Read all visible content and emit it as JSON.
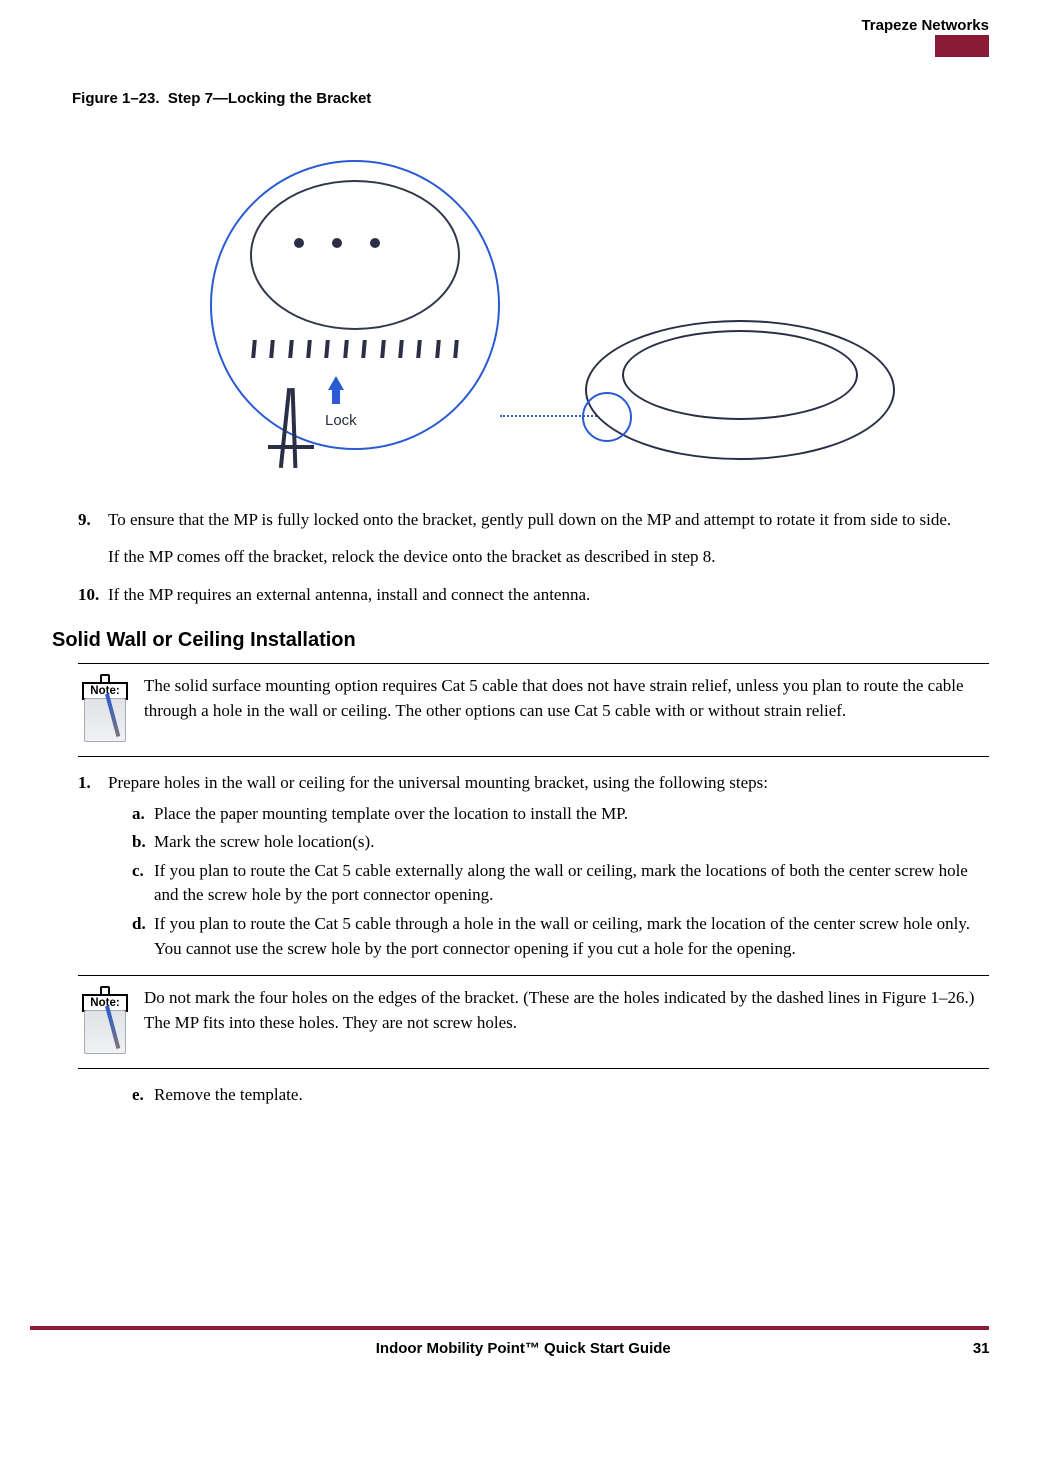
{
  "header": {
    "brand": "Trapeze Networks"
  },
  "figure": {
    "caption_prefix": "Figure 1–23.",
    "caption_title": "Step 7—Locking the Bracket",
    "lock_label": "Lock"
  },
  "steps_top": [
    {
      "num": "9.",
      "text": "To ensure that the MP is fully locked onto the bracket, gently pull down on the MP and attempt to rotate it from side to side.",
      "para2": "If the MP comes off the bracket, relock the device onto the bracket as described in step 8."
    },
    {
      "num": "10.",
      "text": "If the MP requires an external antenna, install and connect the antenna."
    }
  ],
  "section_title": "Solid Wall or Ceiling Installation",
  "note1": {
    "label": "Note:",
    "text": "The solid surface mounting option requires Cat 5 cable that does not have strain relief, unless you plan to route the cable through a hole in the wall or ceiling. The other options can use Cat 5 cable with or without strain relief."
  },
  "step1": {
    "num": "1.",
    "text": "Prepare holes in the wall or ceiling for the universal mounting bracket, using the following steps:",
    "subs": [
      {
        "lab": "a.",
        "text": "Place the paper mounting template over the location to install the MP."
      },
      {
        "lab": "b.",
        "text": "Mark the screw hole location(s)."
      },
      {
        "lab": "c.",
        "text": "If you plan to route the Cat 5 cable externally along the wall or ceiling, mark the locations of both the center screw hole and the screw hole by the port connector opening."
      },
      {
        "lab": "d.",
        "text": "If you plan to route the Cat 5 cable through a hole in the wall or ceiling, mark the location of the center screw hole only. You cannot use the screw hole by the port connector opening if you cut a hole for the opening."
      }
    ]
  },
  "note2": {
    "label": "Note:",
    "text": "Do not mark the four holes on the edges of the bracket. (These are the holes indicated by the dashed lines in Figure 1–26.) The MP fits into these holes. They are not screw holes."
  },
  "step1_e": {
    "lab": "e.",
    "text": "Remove the template."
  },
  "footer": {
    "title": "Indoor Mobility Point™ Quick Start Guide",
    "page": "31"
  }
}
